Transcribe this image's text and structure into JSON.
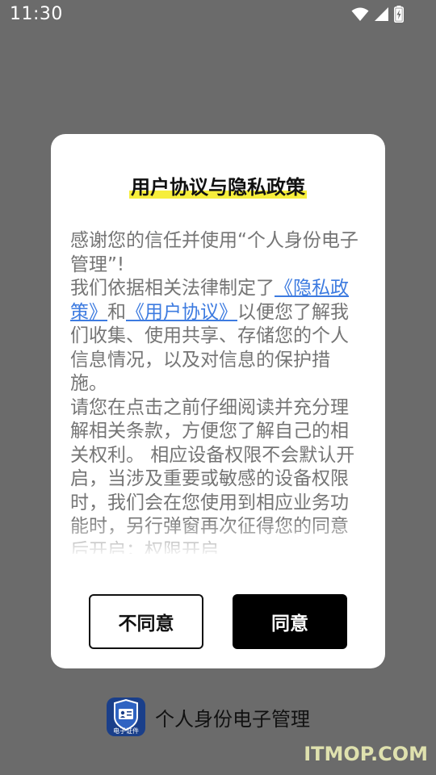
{
  "status_bar": {
    "time": "11:30",
    "icons": [
      "wifi-icon",
      "cell-signal-icon",
      "battery-charging-icon"
    ]
  },
  "dialog": {
    "title": "用户协议与隐私政策",
    "intro": "感谢您的信任并使用“个人身份电子管理”!",
    "p2_before": "我们依据相关法律制定了",
    "privacy_link": "《隐私政策》",
    "and_text": "和",
    "user_agreement_link": "《用户协议》",
    "p2_after": "以便您了解我们收集、使用共享、存储您的个人信息情况，以及对信息的保护措施。",
    "p3": "请您在点击之前仔细阅读并充分理解相关条款，方便您了解自己的相关权利。 相应设备权限不会默认开启，当涉及重要或敏感的设备权限时，我们会在您使用到相应业务功能时，另行弹窗再次征得您的同意后开启；权限开启",
    "disagree_label": "不同意",
    "agree_label": "同意"
  },
  "footer": {
    "app_name": "个人身份电子管理",
    "icon_caption": "电子证件"
  },
  "watermark": "ITMOP.COM",
  "colors": {
    "overlay": "#6b6b6b",
    "link": "#3d7be0",
    "title_highlight": "#f6ee3c",
    "app_icon": "#1a3f8a"
  }
}
